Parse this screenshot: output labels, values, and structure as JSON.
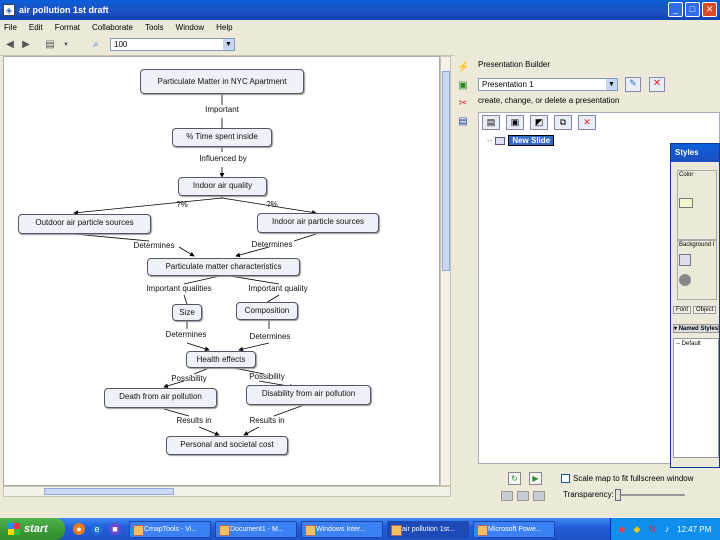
{
  "window": {
    "title": "air pollution 1st draft"
  },
  "menu": [
    "File",
    "Edit",
    "Format",
    "Collaborate",
    "Tools",
    "Window",
    "Help"
  ],
  "toolbar": {
    "zoom": "100"
  },
  "concept_map": {
    "nodes": {
      "n1": "Particulate Matter in NYC Apartment",
      "n2": "% Time spent inside",
      "n3": "Indoor air quality",
      "n4": "Outdoor air particle sources",
      "n5": "Indoor air particle sources",
      "n6": "Particulate matter characteristics",
      "n7": "Size",
      "n8": "Composition",
      "n9": "Health effects",
      "n10": "Death from air pollution",
      "n11": "Disability from air pollution",
      "n12": "Personal and societal cost"
    },
    "links": {
      "l1": "Important",
      "l2": "Influenced by",
      "l3": "?%",
      "l4": "?%",
      "l5": "Determines",
      "l6": "Determines",
      "l7": "Important qualities",
      "l8": "Important quality",
      "l9": "Determines",
      "l10": "Determines",
      "l11": "Possibility",
      "l12": "Possibility",
      "l13": "Results in",
      "l14": "Results in"
    }
  },
  "presentation_builder": {
    "header": "Presentation Builder",
    "selected": "Presentation 1",
    "description": "create, change, or delete a presentation",
    "slide_name": "New Slide",
    "scale_label": "Scale map to fit fullscreen window",
    "transparency_label": "Transparency:",
    "transparency_value": 0
  },
  "styles_panel": {
    "title": "Styles",
    "color_group": "Color",
    "bg_group": "Background I",
    "tab1": "Font",
    "tab2": "Object",
    "named_styles": "Named Styles",
    "default_item": "Default"
  },
  "taskbar": {
    "start": "start",
    "tasks": [
      "CmapTools - Vi...",
      "Document1 - M...",
      "Windows Inter...",
      "air pollution 1st...",
      "Microsoft Powe..."
    ],
    "active_index": 3,
    "clock": "12:47 PM"
  }
}
